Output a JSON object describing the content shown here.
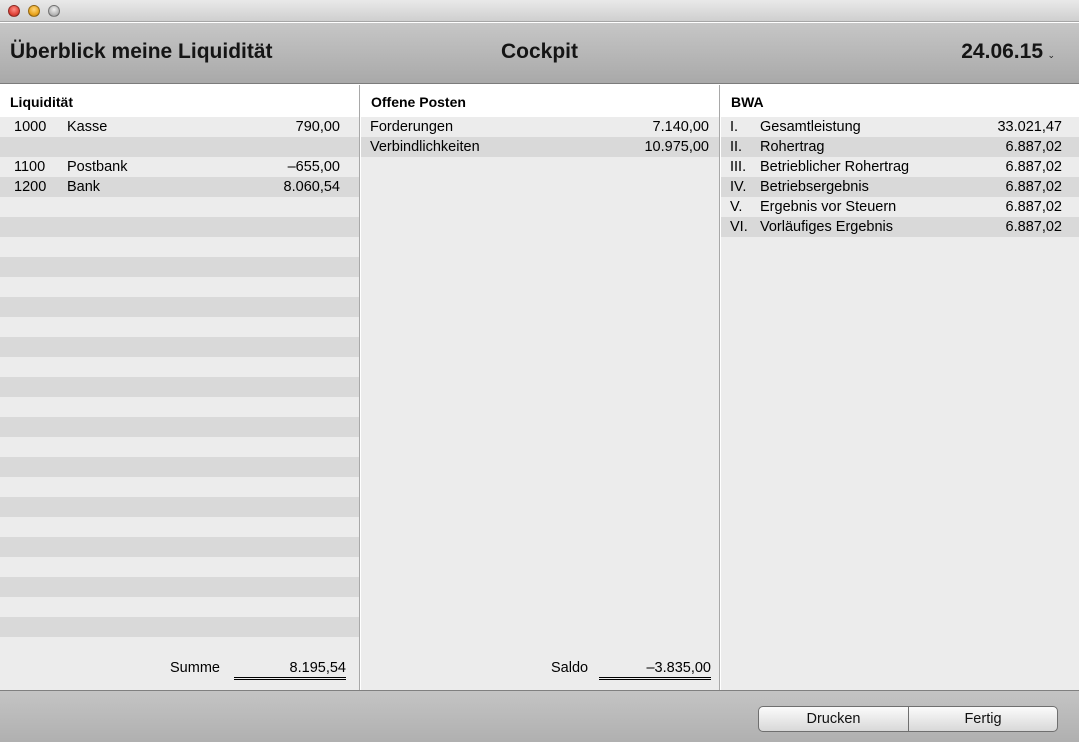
{
  "header": {
    "title": "Überblick meine Liquidität",
    "center": "Cockpit",
    "date": "24.06.15",
    "date_chevron": "⌄"
  },
  "liquiditaet": {
    "heading": "Liquidität",
    "rows": [
      {
        "no": "1000",
        "name": "Kasse",
        "amount": "790,00"
      },
      {
        "no": "",
        "name": "",
        "amount": ""
      },
      {
        "no": "1100",
        "name": "Postbank",
        "amount": "–655,00"
      },
      {
        "no": "1200",
        "name": "Bank",
        "amount": "8.060,54"
      }
    ],
    "total_label": "Summe",
    "total_value": "8.195,54"
  },
  "offene_posten": {
    "heading": "Offene Posten",
    "rows": [
      {
        "name": "Forderungen",
        "amount": "7.140,00"
      },
      {
        "name": "Verbindlichkeiten",
        "amount": "10.975,00"
      }
    ],
    "total_label": "Saldo",
    "total_value": "–3.835,00"
  },
  "bwa": {
    "heading": "BWA",
    "rows": [
      {
        "roman": "I.",
        "name": "Gesamtleistung",
        "amount": "33.021,47"
      },
      {
        "roman": "II.",
        "name": "Rohertrag",
        "amount": "6.887,02"
      },
      {
        "roman": "III.",
        "name": "Betrieblicher Rohertrag",
        "amount": "6.887,02"
      },
      {
        "roman": "IV.",
        "name": "Betriebsergebnis",
        "amount": "6.887,02"
      },
      {
        "roman": "V.",
        "name": "Ergebnis vor Steuern",
        "amount": "6.887,02"
      },
      {
        "roman": "VI.",
        "name": "Vorläufiges Ergebnis",
        "amount": "6.887,02"
      }
    ]
  },
  "footer": {
    "print_label": "Drucken",
    "done_label": "Fertig"
  }
}
